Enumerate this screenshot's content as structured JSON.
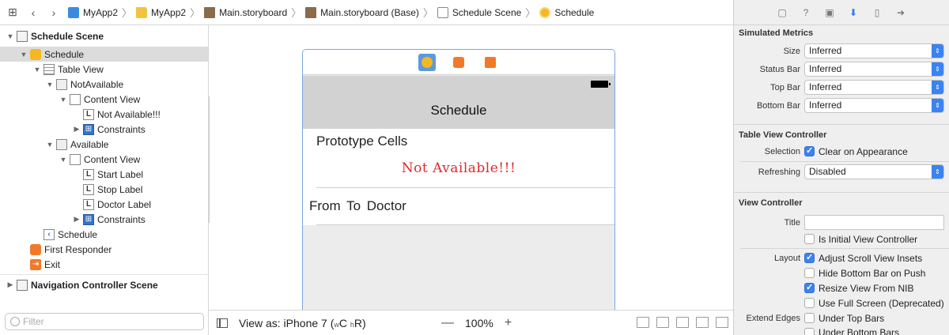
{
  "jumpbar": {
    "crumbs": [
      "MyApp2",
      "MyApp2",
      "Main.storyboard",
      "Main.storyboard (Base)",
      "Schedule Scene",
      "Schedule"
    ]
  },
  "navigator": {
    "rows": [
      {
        "label": "Schedule Scene",
        "icon": "scene-icon"
      },
      {
        "label": "Schedule",
        "icon": "view-controller-icon"
      },
      {
        "label": "Table View",
        "icon": "table-view-icon"
      },
      {
        "label": "NotAvailable",
        "icon": "table-cell-icon"
      },
      {
        "label": "Content View",
        "icon": "view-icon"
      },
      {
        "label": "Not Available!!!",
        "icon": "label-icon"
      },
      {
        "label": "Constraints",
        "icon": "constraints-icon"
      },
      {
        "label": "Available",
        "icon": "table-cell-icon"
      },
      {
        "label": "Content View",
        "icon": "view-icon"
      },
      {
        "label": "Start Label",
        "icon": "label-icon"
      },
      {
        "label": "Stop Label",
        "icon": "label-icon"
      },
      {
        "label": "Doctor Label",
        "icon": "label-icon"
      },
      {
        "label": "Constraints",
        "icon": "constraints-icon"
      },
      {
        "label": "Schedule",
        "icon": "navigation-item-icon"
      },
      {
        "label": "First Responder",
        "icon": "first-responder-icon"
      },
      {
        "label": "Exit",
        "icon": "exit-icon"
      },
      {
        "label": "Navigation Controller Scene",
        "icon": "scene-icon"
      }
    ],
    "label_glyph": "L",
    "filter_placeholder": "Filter"
  },
  "canvas": {
    "nav_title": "Schedule",
    "prototype_cells": "Prototype Cells",
    "not_available": "Not Available!!!",
    "cell_text": "From To Doctor"
  },
  "bottombar": {
    "view_as": "View as: iPhone 7",
    "size_class_open": "(",
    "w": "w",
    "c": "C",
    "h": "h",
    "r": "R)",
    "zoom_out": "—",
    "zoom": "100%",
    "zoom_in": "+"
  },
  "inspector": {
    "simulated_metrics": {
      "title": "Simulated Metrics",
      "size_label": "Size",
      "size_value": "Inferred",
      "status_label": "Status Bar",
      "status_value": "Inferred",
      "top_label": "Top Bar",
      "top_value": "Inferred",
      "bottom_label": "Bottom Bar",
      "bottom_value": "Inferred"
    },
    "table_view_controller": {
      "title": "Table View Controller",
      "selection_label": "Selection",
      "clear_on_appearance": "Clear on Appearance",
      "refreshing_label": "Refreshing",
      "refreshing_value": "Disabled"
    },
    "view_controller": {
      "title": "View Controller",
      "title_label": "Title",
      "initial_vc": "Is Initial View Controller",
      "layout_label": "Layout",
      "adjust_insets": "Adjust Scroll View Insets",
      "hide_bottom": "Hide Bottom Bar on Push",
      "resize_nib": "Resize View From NIB",
      "full_screen": "Use Full Screen (Deprecated)",
      "extend_label": "Extend Edges",
      "under_top": "Under Top Bars",
      "under_bottom": "Under Bottom Bars"
    }
  },
  "colors": {
    "accent": "#3b83f0",
    "selection": "#dcdcdc",
    "not_available_text": "#e0282d"
  }
}
